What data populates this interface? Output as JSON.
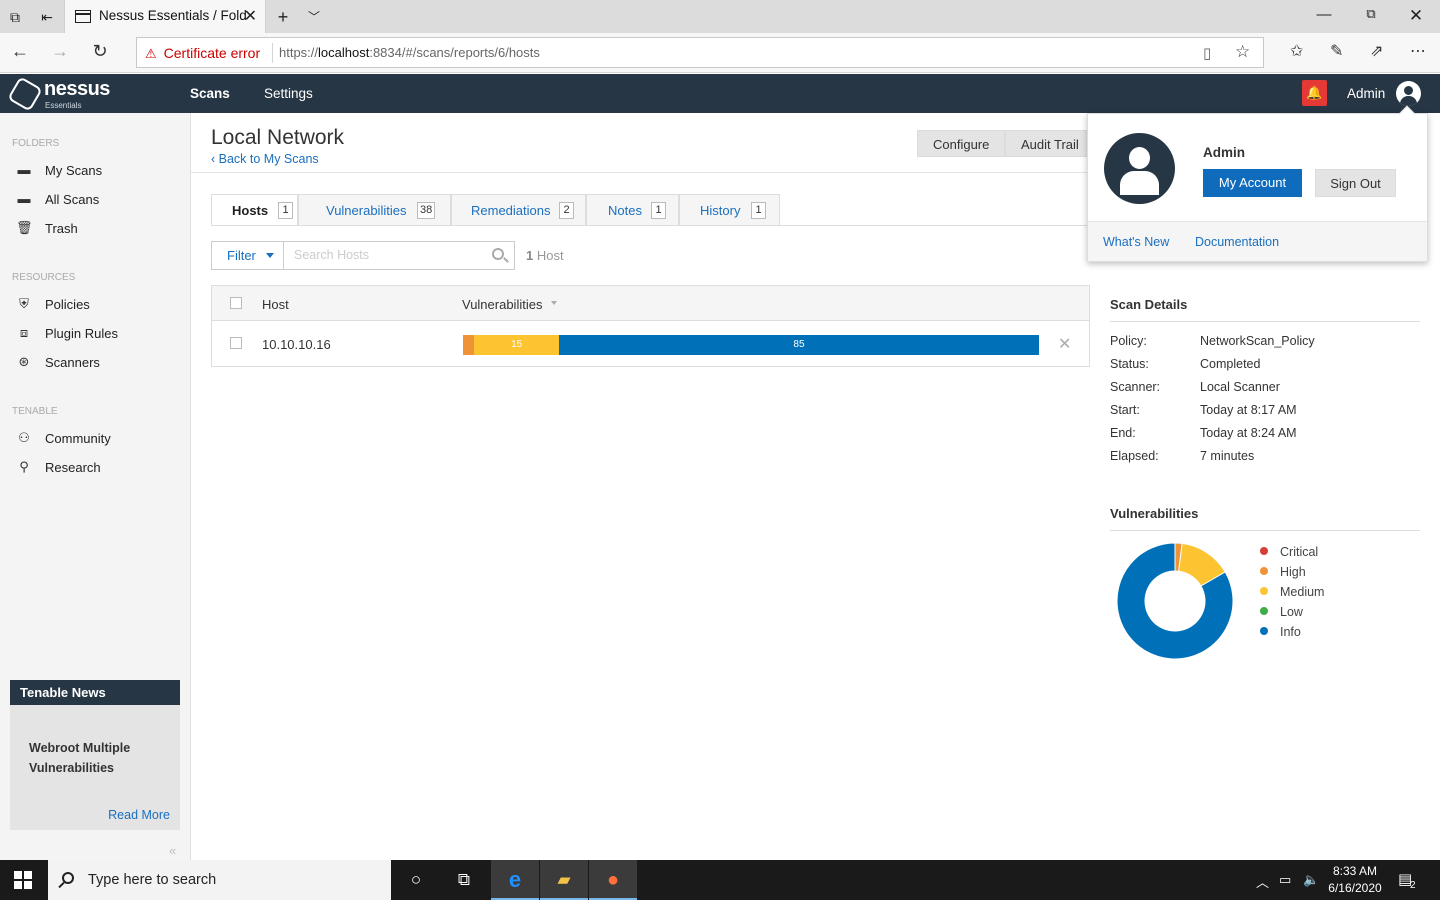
{
  "browser": {
    "tab_title": "Nessus Essentials / Fold",
    "cert_error": "Certificate error",
    "url_prefix": "https://",
    "url_host": "localhost",
    "url_rest": ":8834/#/scans/reports/6/hosts"
  },
  "app": {
    "brand": "nessus",
    "brand_sub": "Essentials",
    "nav": {
      "scans": "Scans",
      "settings": "Settings"
    },
    "user": "Admin"
  },
  "sidebar": {
    "folders_label": "FOLDERS",
    "folders": [
      {
        "label": "My Scans",
        "icon": "folder-icon"
      },
      {
        "label": "All Scans",
        "icon": "folder-icon"
      },
      {
        "label": "Trash",
        "icon": "trash-icon"
      }
    ],
    "resources_label": "RESOURCES",
    "resources": [
      {
        "label": "Policies",
        "icon": "shield-icon"
      },
      {
        "label": "Plugin Rules",
        "icon": "plugin-icon"
      },
      {
        "label": "Scanners",
        "icon": "radar-icon"
      }
    ],
    "tenable_label": "TENABLE",
    "tenable": [
      {
        "label": "Community",
        "icon": "community-icon"
      },
      {
        "label": "Research",
        "icon": "research-icon"
      }
    ],
    "news": {
      "header": "Tenable News",
      "headline": "Webroot Multiple Vulnerabilities",
      "read_more": "Read More"
    }
  },
  "main": {
    "title": "Local Network",
    "back_link": "Back to My Scans",
    "configure": "Configure",
    "audit_trail": "Audit Trail",
    "tabs": [
      {
        "label": "Hosts",
        "count": "1"
      },
      {
        "label": "Vulnerabilities",
        "count": "38"
      },
      {
        "label": "Remediations",
        "count": "2"
      },
      {
        "label": "Notes",
        "count": "1"
      },
      {
        "label": "History",
        "count": "1"
      }
    ],
    "filter": "Filter",
    "search_placeholder": "Search Hosts",
    "host_count_num": "1",
    "host_count_word": "Host",
    "table": {
      "col_host": "Host",
      "col_vulns": "Vulnerabilities",
      "rows": [
        {
          "host": "10.10.10.16",
          "high": 2,
          "medium": 15,
          "info": 85,
          "medium_label": "15",
          "info_label": "85"
        }
      ]
    }
  },
  "scan_details": {
    "title": "Scan Details",
    "items": [
      {
        "k": "Policy:",
        "v": "NetworkScan_Policy"
      },
      {
        "k": "Status:",
        "v": "Completed"
      },
      {
        "k": "Scanner:",
        "v": "Local Scanner"
      },
      {
        "k": "Start:",
        "v": "Today at 8:17 AM"
      },
      {
        "k": "End:",
        "v": "Today at 8:24 AM"
      },
      {
        "k": "Elapsed:",
        "v": "7 minutes"
      }
    ]
  },
  "vuln_chart": {
    "title": "Vulnerabilities",
    "legend": [
      {
        "label": "Critical",
        "color": "#d43f3a"
      },
      {
        "label": "High",
        "color": "#ee9336"
      },
      {
        "label": "Medium",
        "color": "#fdc431"
      },
      {
        "label": "Low",
        "color": "#3fae49"
      },
      {
        "label": "Info",
        "color": "#0071b9"
      }
    ]
  },
  "chart_data": {
    "type": "pie",
    "title": "Vulnerabilities",
    "categories": [
      "Critical",
      "High",
      "Medium",
      "Low",
      "Info"
    ],
    "values": [
      0,
      2,
      15,
      0,
      85
    ],
    "donut": true
  },
  "dropdown": {
    "name": "Admin",
    "my_account": "My Account",
    "sign_out": "Sign Out",
    "whats_new": "What's New",
    "documentation": "Documentation"
  },
  "taskbar": {
    "search_text": "Type here to search",
    "time": "8:33 AM",
    "date": "6/16/2020",
    "notif_count": "2"
  },
  "colors": {
    "nav_bg": "#263645",
    "link": "#1a6fbf",
    "high": "#ee9336",
    "medium": "#fdc431",
    "info": "#0071b9"
  }
}
